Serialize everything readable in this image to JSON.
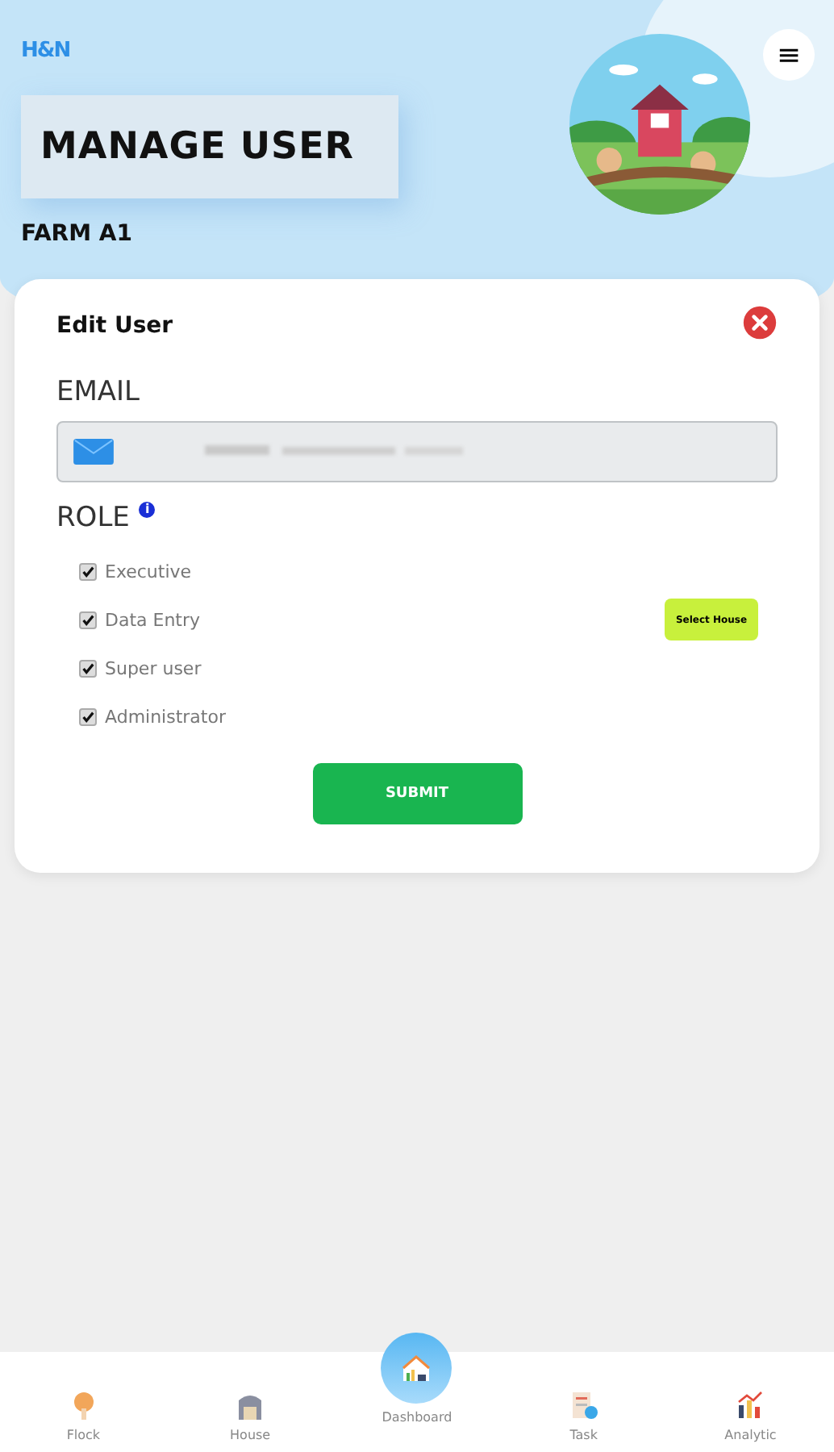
{
  "header": {
    "logo": "H&N",
    "title": "MANAGE USER",
    "farm": "FARM A1",
    "menu_icon": "≡"
  },
  "dialog": {
    "title": "Edit User",
    "email_label": "EMAIL",
    "role_label": "ROLE",
    "info_badge": "i",
    "roles": [
      {
        "label": "Executive",
        "checked": true
      },
      {
        "label": "Data Entry",
        "checked": true,
        "action": "Select House"
      },
      {
        "label": "Super user",
        "checked": true
      },
      {
        "label": "Administrator",
        "checked": true
      }
    ],
    "submit": "SUBMIT"
  },
  "nav": [
    {
      "label": "Flock",
      "kind": "flock",
      "selected": false
    },
    {
      "label": "House",
      "kind": "house",
      "selected": false
    },
    {
      "label": "Dashboard",
      "kind": "dashboard",
      "selected": true
    },
    {
      "label": "Task",
      "kind": "task",
      "selected": false
    },
    {
      "label": "Analytic",
      "kind": "analytic",
      "selected": false
    }
  ]
}
